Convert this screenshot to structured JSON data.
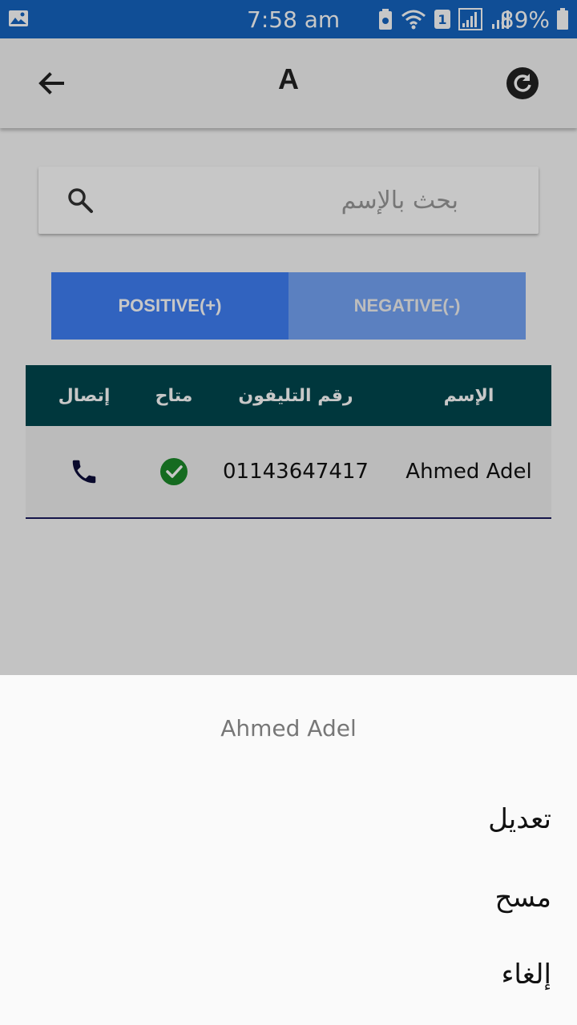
{
  "status_bar": {
    "time": "7:58 am",
    "battery": "89%",
    "sim_number": "1"
  },
  "toolbar": {
    "title": "A"
  },
  "search": {
    "placeholder": "بحث بالإسم"
  },
  "tabs": [
    {
      "label": "POSITIVE(+)",
      "active": true
    },
    {
      "label": "NEGATIVE(-)",
      "active": false
    }
  ],
  "table": {
    "headers": {
      "call": "إتصال",
      "available": "متاح",
      "phone": "رقم التليفون",
      "name": "الإسم"
    },
    "rows": [
      {
        "name": "Ahmed Adel",
        "phone": "01143647417",
        "available": true
      }
    ]
  },
  "dialog": {
    "title": "Ahmed Adel",
    "edit_label": "تعديل",
    "delete_label": "مسح",
    "cancel_label": "إلغاء"
  },
  "colors": {
    "status_bar": "#1565c0",
    "tab_active": "#3f7ff5",
    "tab_inactive": "#75a4f7",
    "table_header": "#00474f",
    "check": "#1b8a2a",
    "phone_icon": "#0d0d3a"
  }
}
